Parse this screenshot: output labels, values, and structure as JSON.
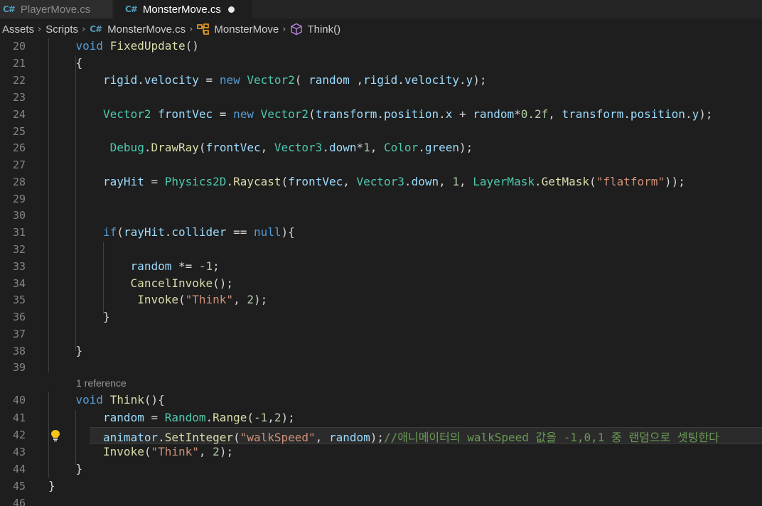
{
  "tabs": [
    {
      "name": "PlayerMove.cs",
      "active": false
    },
    {
      "name": "MonsterMove.cs",
      "active": true,
      "dirty": true
    }
  ],
  "tab_icon_glyph": "C#",
  "breadcrumb": {
    "items": [
      "Assets",
      "Scripts",
      "MonsterMove.cs",
      "MonsterMove",
      "Think()"
    ]
  },
  "codelens": "1 reference",
  "colors": {
    "keyword": "#569cd6",
    "type": "#4ec9b0",
    "function": "#dcdcaa",
    "variable": "#9cdcfe",
    "string": "#ce9178",
    "number": "#b5cea8",
    "comment": "#6a9955"
  },
  "lines": [
    {
      "n": "20",
      "tokens": [
        [
          "kw",
          "void"
        ],
        [
          "pl",
          " "
        ],
        [
          "fn",
          "FixedUpdate"
        ],
        [
          "pl",
          "()"
        ]
      ]
    },
    {
      "n": "21",
      "tokens": [
        [
          "pl",
          "{"
        ]
      ]
    },
    {
      "n": "22",
      "tokens": [
        [
          "va",
          "rigid"
        ],
        [
          "pl",
          "."
        ],
        [
          "va",
          "velocity"
        ],
        [
          "pl",
          " = "
        ],
        [
          "kw",
          "new"
        ],
        [
          "pl",
          " "
        ],
        [
          "ty",
          "Vector2"
        ],
        [
          "pl",
          "( "
        ],
        [
          "va",
          "random"
        ],
        [
          "pl",
          " ,"
        ],
        [
          "va",
          "rigid"
        ],
        [
          "pl",
          "."
        ],
        [
          "va",
          "velocity"
        ],
        [
          "pl",
          "."
        ],
        [
          "va",
          "y"
        ],
        [
          "pl",
          ");"
        ]
      ]
    },
    {
      "n": "23",
      "tokens": []
    },
    {
      "n": "24",
      "tokens": [
        [
          "ty",
          "Vector2"
        ],
        [
          "pl",
          " "
        ],
        [
          "va",
          "frontVec"
        ],
        [
          "pl",
          " = "
        ],
        [
          "kw",
          "new"
        ],
        [
          "pl",
          " "
        ],
        [
          "ty",
          "Vector2"
        ],
        [
          "pl",
          "("
        ],
        [
          "va",
          "transform"
        ],
        [
          "pl",
          "."
        ],
        [
          "va",
          "position"
        ],
        [
          "pl",
          "."
        ],
        [
          "va",
          "x"
        ],
        [
          "pl",
          " + "
        ],
        [
          "va",
          "random"
        ],
        [
          "pl",
          "*"
        ],
        [
          "nu",
          "0.2f"
        ],
        [
          "pl",
          ", "
        ],
        [
          "va",
          "transform"
        ],
        [
          "pl",
          "."
        ],
        [
          "va",
          "position"
        ],
        [
          "pl",
          "."
        ],
        [
          "va",
          "y"
        ],
        [
          "pl",
          ");"
        ]
      ]
    },
    {
      "n": "25",
      "tokens": []
    },
    {
      "n": "26",
      "tokens": [
        [
          "ty",
          "Debug"
        ],
        [
          "pl",
          "."
        ],
        [
          "fn",
          "DrawRay"
        ],
        [
          "pl",
          "("
        ],
        [
          "va",
          "frontVec"
        ],
        [
          "pl",
          ", "
        ],
        [
          "ty",
          "Vector3"
        ],
        [
          "pl",
          "."
        ],
        [
          "va",
          "down"
        ],
        [
          "pl",
          "*"
        ],
        [
          "nu",
          "1"
        ],
        [
          "pl",
          ", "
        ],
        [
          "ty",
          "Color"
        ],
        [
          "pl",
          "."
        ],
        [
          "va",
          "green"
        ],
        [
          "pl",
          ");"
        ]
      ]
    },
    {
      "n": "27",
      "tokens": []
    },
    {
      "n": "28",
      "tokens": [
        [
          "va",
          "rayHit"
        ],
        [
          "pl",
          " = "
        ],
        [
          "ty",
          "Physics2D"
        ],
        [
          "pl",
          "."
        ],
        [
          "fn",
          "Raycast"
        ],
        [
          "pl",
          "("
        ],
        [
          "va",
          "frontVec"
        ],
        [
          "pl",
          ", "
        ],
        [
          "ty",
          "Vector3"
        ],
        [
          "pl",
          "."
        ],
        [
          "va",
          "down"
        ],
        [
          "pl",
          ", "
        ],
        [
          "nu",
          "1"
        ],
        [
          "pl",
          ", "
        ],
        [
          "ty",
          "LayerMask"
        ],
        [
          "pl",
          "."
        ],
        [
          "fn",
          "GetMask"
        ],
        [
          "pl",
          "("
        ],
        [
          "st",
          "\"flatform\""
        ],
        [
          "pl",
          "));"
        ]
      ]
    },
    {
      "n": "29",
      "tokens": []
    },
    {
      "n": "30",
      "tokens": []
    },
    {
      "n": "31",
      "tokens": [
        [
          "kw",
          "if"
        ],
        [
          "pl",
          "("
        ],
        [
          "va",
          "rayHit"
        ],
        [
          "pl",
          "."
        ],
        [
          "va",
          "collider"
        ],
        [
          "pl",
          " == "
        ],
        [
          "kw",
          "null"
        ],
        [
          "pl",
          "){"
        ]
      ]
    },
    {
      "n": "32",
      "tokens": []
    },
    {
      "n": "33",
      "tokens": [
        [
          "va",
          "random"
        ],
        [
          "pl",
          " *= "
        ],
        [
          "nu",
          "-1"
        ],
        [
          "pl",
          ";"
        ]
      ]
    },
    {
      "n": "34",
      "tokens": [
        [
          "fn",
          "CancelInvoke"
        ],
        [
          "pl",
          "();"
        ]
      ]
    },
    {
      "n": "35",
      "tokens": [
        [
          "fn",
          "Invoke"
        ],
        [
          "pl",
          "("
        ],
        [
          "st",
          "\"Think\""
        ],
        [
          "pl",
          ", "
        ],
        [
          "nu",
          "2"
        ],
        [
          "pl",
          ");"
        ]
      ]
    },
    {
      "n": "36",
      "tokens": [
        [
          "pl",
          "}"
        ]
      ]
    },
    {
      "n": "37",
      "tokens": []
    },
    {
      "n": "38",
      "tokens": [
        [
          "pl",
          "}"
        ]
      ]
    },
    {
      "n": "39",
      "tokens": []
    },
    {
      "n": "40",
      "tokens": [
        [
          "kw",
          "void"
        ],
        [
          "pl",
          " "
        ],
        [
          "fn",
          "Think"
        ],
        [
          "pl",
          "(){"
        ]
      ]
    },
    {
      "n": "41",
      "tokens": [
        [
          "va",
          "random"
        ],
        [
          "pl",
          " = "
        ],
        [
          "ty",
          "Random"
        ],
        [
          "pl",
          "."
        ],
        [
          "fn",
          "Range"
        ],
        [
          "pl",
          "("
        ],
        [
          "nu",
          "-1"
        ],
        [
          "pl",
          ","
        ],
        [
          "nu",
          "2"
        ],
        [
          "pl",
          ");"
        ]
      ]
    },
    {
      "n": "42",
      "tokens": [
        [
          "va",
          "animator"
        ],
        [
          "pl",
          "."
        ],
        [
          "fn",
          "SetInteger"
        ],
        [
          "pl",
          "("
        ],
        [
          "st",
          "\"walkSpeed\""
        ],
        [
          "pl",
          ", "
        ],
        [
          "va",
          "random"
        ],
        [
          "pl",
          ");"
        ],
        [
          "cm",
          "//애니메이터의 walkSpeed 값을 -1,0,1 중 랜덤으로 셋팅한다"
        ]
      ]
    },
    {
      "n": "43",
      "tokens": [
        [
          "fn",
          "Invoke"
        ],
        [
          "pl",
          "("
        ],
        [
          "st",
          "\"Think\""
        ],
        [
          "pl",
          ", "
        ],
        [
          "nu",
          "2"
        ],
        [
          "pl",
          ");"
        ]
      ]
    },
    {
      "n": "44",
      "tokens": [
        [
          "pl",
          "}"
        ]
      ]
    },
    {
      "n": "45",
      "tokens": [
        [
          "pl",
          "}"
        ]
      ]
    },
    {
      "n": "46",
      "tokens": []
    }
  ]
}
